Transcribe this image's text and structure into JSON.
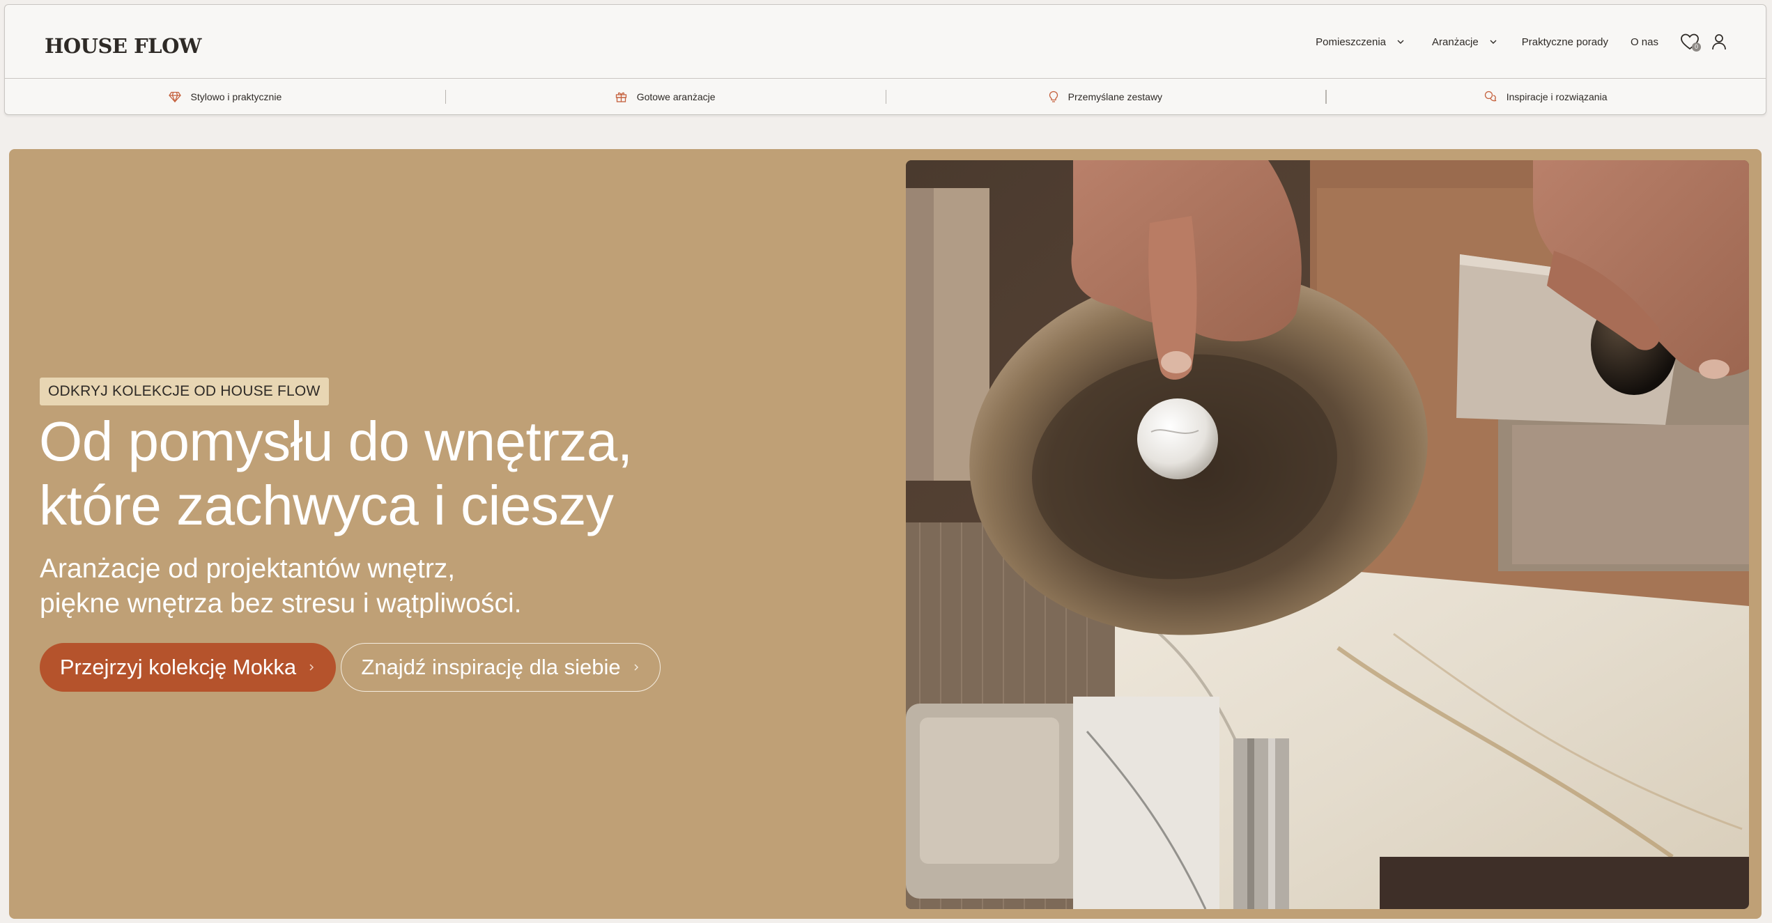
{
  "header": {
    "logo": "HOUSE FLOW",
    "nav": {
      "rooms": "Pomieszczenia",
      "arrangements": "Aranżacje",
      "tips": "Praktyczne porady",
      "about": "O nas"
    },
    "wishlist_count": "0"
  },
  "features": [
    {
      "label": "Stylowo i praktycznie",
      "icon": "diamond-icon"
    },
    {
      "label": "Gotowe aranżacje",
      "icon": "gift-icon"
    },
    {
      "label": "Przemyślane zestawy",
      "icon": "lightbulb-icon"
    },
    {
      "label": "Inspiracje i rozwiązania",
      "icon": "chat-bubbles-icon"
    }
  ],
  "hero": {
    "eyebrow": "ODKRYJ KOLEKCJE OD HOUSE FLOW",
    "headline_line1": "Od pomysłu do wnętrza,",
    "headline_line2": "które zachwyca i cieszy",
    "sub_line1": "Aranżacje od projektantów wnętrz,",
    "sub_line2": "piękne wnętrza bez stresu i wątpliwości.",
    "primary_cta": "Przejrzyj kolekcję Mokka",
    "secondary_cta": "Znajdź inspirację dla siebie"
  },
  "colors": {
    "hero_bg": "#bfa076",
    "primary_button": "#b5532c",
    "eyebrow_bg": "#e8d6b3",
    "icon_accent": "#c4603c"
  }
}
